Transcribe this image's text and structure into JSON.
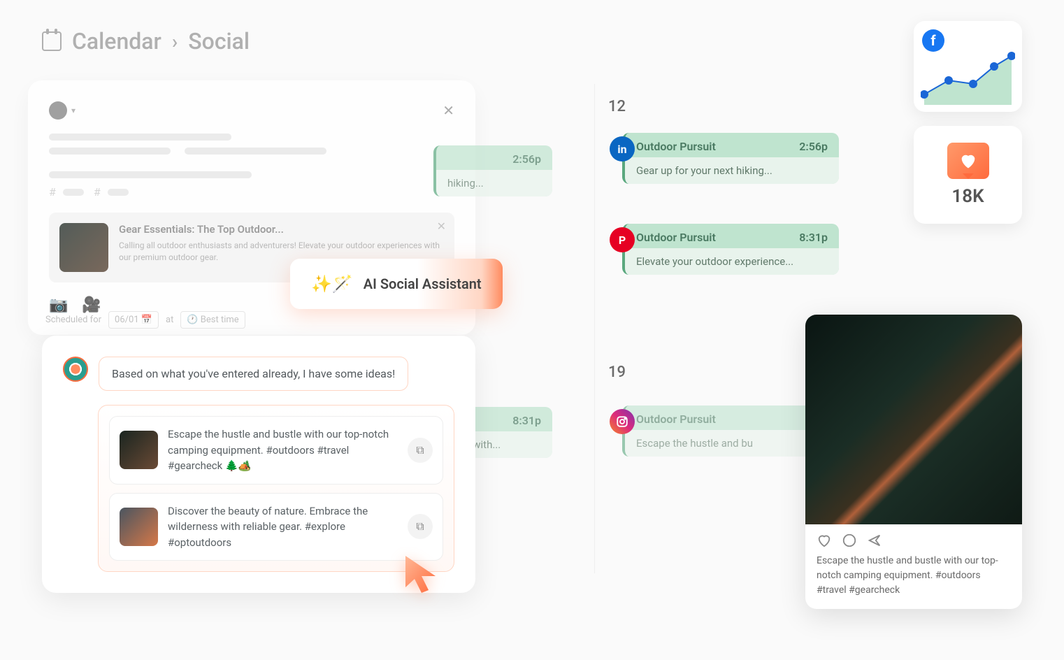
{
  "breadcrumb": {
    "one": "Calendar",
    "two": "Social"
  },
  "compose": {
    "attachment_title": "Gear Essentials: The Top Outdoor...",
    "attachment_desc": "Calling all outdoor enthusiasts and adventurers! Elevate your outdoor experiences with our premium outdoor gear."
  },
  "schedule": {
    "label": "Scheduled for",
    "date": "06/01",
    "at": "at",
    "best": "Best time"
  },
  "ai_button": "AI Social Assistant",
  "assistant": {
    "intro": "Based on what you've entered already, I have some ideas!",
    "s1": "Escape the hustle and bustle with our top-notch camping equipment. #outdoors #travel #gearcheck 🌲🏕️",
    "s2": "Discover the beauty of nature. Embrace the wilderness with reliable gear. #explore #optoutdoors"
  },
  "days": {
    "d12": "12",
    "d19": "19"
  },
  "events": {
    "e1": {
      "title": "Outdoor Pursuit",
      "time": "2:56p",
      "body": "Gear up for your next hiking..."
    },
    "e2": {
      "title": "Outdoor Pursuit",
      "time": "8:31p",
      "body": "Elevate your outdoor experience..."
    },
    "e3": {
      "time": "2:56p",
      "body": "hiking..."
    },
    "e4": {
      "time": "8:31p",
      "body": "ustle with..."
    },
    "e5": {
      "title": "Outdoor Pursuit",
      "body": "Escape the hustle and bu"
    }
  },
  "stats": {
    "likes": "18K"
  },
  "preview": {
    "caption": "Escape the hustle and bustle with our top-notch camping equipment. #outdoors #travel #gearcheck"
  }
}
